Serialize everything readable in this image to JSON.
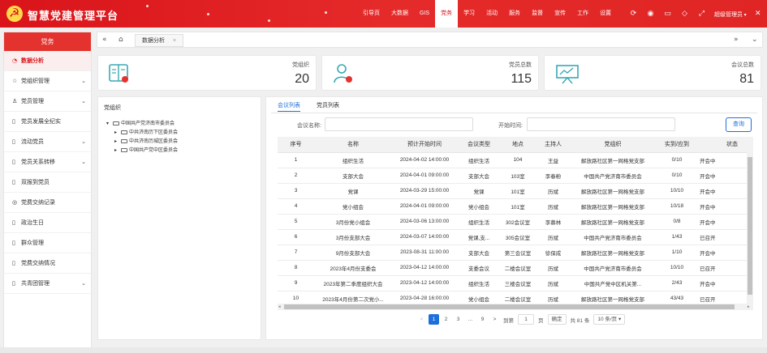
{
  "header": {
    "app_title": "智慧党建管理平台",
    "nav": [
      "引导页",
      "大数据",
      "GIS",
      "党务",
      "学习",
      "活动",
      "服务",
      "监督",
      "宣传",
      "工作",
      "设置"
    ],
    "nav_active_index": 3,
    "user_name": "超级管理员",
    "close_glyph": "✕",
    "icons": [
      "refresh-icon",
      "bell-icon",
      "message-icon",
      "tag-icon",
      "fullscreen-icon"
    ]
  },
  "sidebar": {
    "title": "党务",
    "items": [
      {
        "label": "数据分析",
        "icon": "chart-icon",
        "active": true,
        "expandable": false
      },
      {
        "label": "党组织管理",
        "icon": "star-icon",
        "active": false,
        "expandable": true
      },
      {
        "label": "党员管理",
        "icon": "user-icon",
        "active": false,
        "expandable": true
      },
      {
        "label": "党员发展全纪实",
        "icon": "doc-icon",
        "active": false,
        "expandable": false
      },
      {
        "label": "流动党员",
        "icon": "doc-icon",
        "active": false,
        "expandable": true
      },
      {
        "label": "党员关系转移",
        "icon": "doc-icon",
        "active": false,
        "expandable": true
      },
      {
        "label": "双报到党员",
        "icon": "doc-icon",
        "active": false,
        "expandable": false
      },
      {
        "label": "党费交纳记录",
        "icon": "circle-icon",
        "active": false,
        "expandable": false
      },
      {
        "label": "政治生日",
        "icon": "doc-icon",
        "active": false,
        "expandable": false
      },
      {
        "label": "群众管理",
        "icon": "doc-icon",
        "active": false,
        "expandable": false
      },
      {
        "label": "党费交纳情况",
        "icon": "doc-icon",
        "active": false,
        "expandable": false
      },
      {
        "label": "共青团管理",
        "icon": "doc-icon",
        "active": false,
        "expandable": true
      }
    ]
  },
  "tabbar": {
    "tab_label": "数据分析",
    "tab_close": "×"
  },
  "stats": [
    {
      "label": "党组织",
      "value": "20",
      "icon": "org-icon"
    },
    {
      "label": "党员总数",
      "value": "115",
      "icon": "member-icon"
    },
    {
      "label": "会议总数",
      "value": "81",
      "icon": "meeting-icon"
    }
  ],
  "org_tree": {
    "title": "党组织",
    "root": "中国共产党济南市委员会",
    "children": [
      "中共济南历下区委员会",
      "中共济南历城区委员会",
      "中国共产党中区委员会"
    ]
  },
  "meetings": {
    "tabs": [
      "会议列表",
      "党员列表"
    ],
    "active_tab": 0,
    "filters": {
      "name_label": "会议名称:",
      "time_label": "开始时间:",
      "search_label": "查询"
    },
    "columns": [
      "序号",
      "名称",
      "预计开始时间",
      "会议类型",
      "地点",
      "主持人",
      "党组织",
      "实到/应到",
      "状态"
    ],
    "rows": [
      [
        "1",
        "组织生活",
        "2024-04-02 14:00:00",
        "组织生活",
        "104",
        "王益",
        "解放路社区第一网格党支部",
        "0/10",
        "开会中"
      ],
      [
        "2",
        "支部大会",
        "2024-04-01 09:00:00",
        "支部大会",
        "103室",
        "李春粉",
        "中国共产党济南市委员会",
        "0/10",
        "开会中"
      ],
      [
        "3",
        "党课",
        "2024-03-29 15:00:00",
        "党课",
        "101室",
        "历斌",
        "解放路社区第一网格党支部",
        "10/10",
        "开会中"
      ],
      [
        "4",
        "党小组会",
        "2024-04-01 09:00:00",
        "党小组会",
        "101室",
        "历斌",
        "解放路社区第一网格党支部",
        "10/18",
        "开会中"
      ],
      [
        "5",
        "3月份党小组会",
        "2024-03-06 13:00:00",
        "组织生活",
        "302会议室",
        "李慕林",
        "解放路社区第一网格党支部",
        "0/8",
        "开会中"
      ],
      [
        "6",
        "3月份支部大会",
        "2024-03-07 14:00:00",
        "党课,支...",
        "305会议室",
        "历斌",
        "中国共产党济南市委员会",
        "1/43",
        "已召开"
      ],
      [
        "7",
        "9月份支部大会",
        "2023-08-31 11:00:00",
        "支部大会",
        "第三会议室",
        "徐保成",
        "解放路社区第一网格党支部",
        "1/10",
        "开会中"
      ],
      [
        "8",
        "2023年4月份支委会",
        "2023-04-12 14:00:00",
        "支委会议",
        "二楼会议室",
        "历斌",
        "中国共产党济南市委员会",
        "10/10",
        "已召开"
      ],
      [
        "9",
        "2023年第二季度组织大会",
        "2023-04-12 14:00:00",
        "组织生活",
        "三楼会议室",
        "历斌",
        "中国共产党中区机关第...",
        "2/43",
        "开会中"
      ],
      [
        "10",
        "2023年4月份第二次党小...",
        "2023-04-28 16:00:00",
        "党小组会",
        "二楼会议室",
        "历斌",
        "解放路社区第一网格党支部",
        "43/43",
        "已召开"
      ]
    ]
  },
  "pagination": {
    "prev": "<",
    "pages": [
      "1",
      "2",
      "3",
      "...",
      "9"
    ],
    "active_page": "1",
    "next": ">",
    "goto_label": "到第",
    "goto_value": "1",
    "page_unit": "页",
    "confirm_label": "确定",
    "total_label": "共 81 条",
    "page_size": "10 条/页"
  },
  "colors": {
    "brand_red": "#d9141a",
    "accent_blue": "#1e6fd9",
    "icon_teal": "#3aa8b4"
  }
}
